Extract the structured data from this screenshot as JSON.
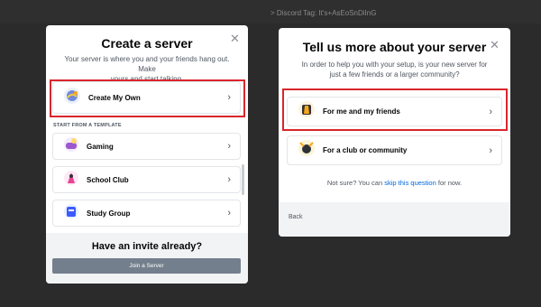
{
  "background": {
    "top_text": "> Discord Tag: It's+AsEoSnDiInG"
  },
  "left_modal": {
    "title": "Create a server",
    "subtitle_line1": "Your server is where you and your friends hang out. Make",
    "subtitle_line2": "yours and start talking.",
    "create_option_label": "Create My Own",
    "section_label": "START FROM A TEMPLATE",
    "templates": [
      {
        "label": "Gaming",
        "icon": "gaming-icon"
      },
      {
        "label": "School Club",
        "icon": "school-club-icon"
      },
      {
        "label": "Study Group",
        "icon": "study-group-icon"
      }
    ],
    "invite_title": "Have an invite already?",
    "join_button": "Join a Server"
  },
  "right_modal": {
    "title": "Tell us more about your server",
    "subtitle_line1": "In order to help you with your setup, is your new server for",
    "subtitle_line2": "just a few friends or a larger community?",
    "options": [
      {
        "label": "For me and my friends",
        "icon": "friends-icon"
      },
      {
        "label": "For a club or community",
        "icon": "community-icon"
      }
    ],
    "not_sure_prefix": "Not sure? You can",
    "not_sure_link": "skip this question",
    "not_sure_suffix": "for now.",
    "back_label": "Back"
  },
  "colors": {
    "highlight": "#d9262d",
    "join_button_bg": "#747f8d",
    "link": "#0068e0"
  }
}
